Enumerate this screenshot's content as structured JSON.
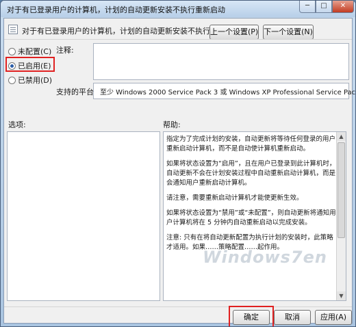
{
  "window": {
    "title": "对于有已登录用户的计算机，计划的自动更新安装不执行重新启动",
    "minimize_glyph": "─",
    "maximize_glyph": "□",
    "close_glyph": "✕"
  },
  "header": {
    "policy_name": "对于有已登录用户的计算机，计划的自动更新安装不执行重新启动",
    "prev_button": "上一个设置(P)",
    "next_button": "下一个设置(N)"
  },
  "state_options": [
    {
      "label": "未配置(C)",
      "selected": false
    },
    {
      "label": "已启用(E)",
      "selected": true
    },
    {
      "label": "已禁用(D)",
      "selected": false
    }
  ],
  "comment": {
    "label": "注释:",
    "value": ""
  },
  "supported_on": {
    "label": "支持的平台:",
    "value": "至少 Windows 2000 Service Pack 3 或 Windows XP Professional Service Pack 1"
  },
  "options": {
    "label": "选项:"
  },
  "help": {
    "label": "帮助:",
    "paragraphs": [
      "指定为了完成计划的安装，自动更新将等待任何登录的用户重新启动计算机，而不是自动使计算机重新启动。",
      "如果将状态设置为“启用”，且在用户已登录到此计算机时，自动更新不会在计划安装过程中自动重新启动计算机，而是会通知用户重新启动计算机。",
      "请注意，需要重新启动计算机才能使更新生效。",
      "如果将状态设置为“禁用”或“未配置”，则自动更新将通知用户计算机将在 5 分钟内自动重新启动以完成安装。",
      "注意: 只有在将自动更新配置为执行计划的安装时，此策略才适用。如果……策略配置……起作用。"
    ]
  },
  "watermark": "Windows7en",
  "footer": {
    "ok_button": "确定",
    "cancel_button": "取消",
    "apply_button": "应用(A)"
  },
  "colors": {
    "highlight": "#e02020",
    "titlebar": "#b7cfe8"
  }
}
